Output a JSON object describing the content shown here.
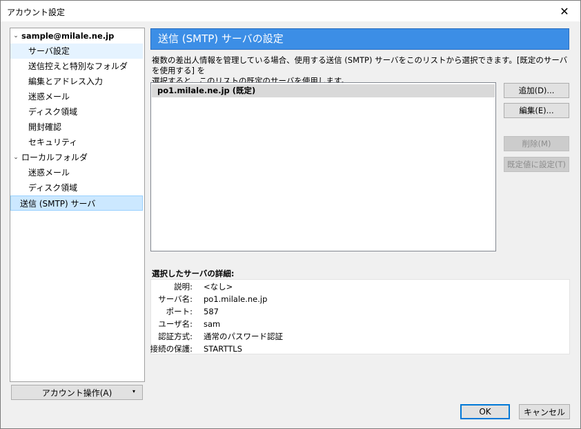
{
  "window": {
    "title": "アカウント設定",
    "close": "✕"
  },
  "tree": {
    "items": [
      {
        "label": "sample@milale.ne.jp",
        "level": 0,
        "expanded": true,
        "bold": true
      },
      {
        "label": "サーバ設定",
        "level": 1,
        "state": "selected-light"
      },
      {
        "label": "送信控えと特別なフォルダ",
        "level": 1
      },
      {
        "label": "編集とアドレス入力",
        "level": 1
      },
      {
        "label": "迷惑メール",
        "level": 1
      },
      {
        "label": "ディスク領域",
        "level": 1
      },
      {
        "label": "開封確認",
        "level": 1
      },
      {
        "label": "セキュリティ",
        "level": 1
      },
      {
        "label": "ローカルフォルダ",
        "level": 0,
        "expanded": true
      },
      {
        "label": "迷惑メール",
        "level": 1
      },
      {
        "label": "ディスク領域",
        "level": 1
      },
      {
        "label": "送信 (SMTP) サーバ",
        "level": 0,
        "state": "selected"
      }
    ]
  },
  "account_actions": {
    "label": "アカウント操作(A)",
    "arrow": "▾"
  },
  "header": {
    "title": "送信 (SMTP) サーバの設定"
  },
  "description": {
    "line1": "複数の差出人情報を管理している場合、使用する送信 (SMTP) サーバをこのリストから選択できます。[既定のサーバを使用する] を",
    "line2": "選択すると、このリストの既定のサーバを使用します。"
  },
  "server_list": {
    "items": [
      "po1.milale.ne.jp (既定)"
    ]
  },
  "buttons": {
    "add": "追加(D)...",
    "edit": "編集(E)...",
    "remove": "削除(M)",
    "set_default": "既定値に設定(T)"
  },
  "details": {
    "title": "選択したサーバの詳細:",
    "rows": [
      {
        "key": "説明:",
        "value": "<なし>"
      },
      {
        "key": "サーバ名:",
        "value": "po1.milale.ne.jp"
      },
      {
        "key": "ポート:",
        "value": "587"
      },
      {
        "key": "ユーザ名:",
        "value": "sam"
      },
      {
        "key": "認証方式:",
        "value": "通常のパスワード認証"
      },
      {
        "key": "接続の保護:",
        "value": "STARTTLS"
      }
    ]
  },
  "footer": {
    "ok": "OK",
    "cancel": "キャンセル"
  }
}
